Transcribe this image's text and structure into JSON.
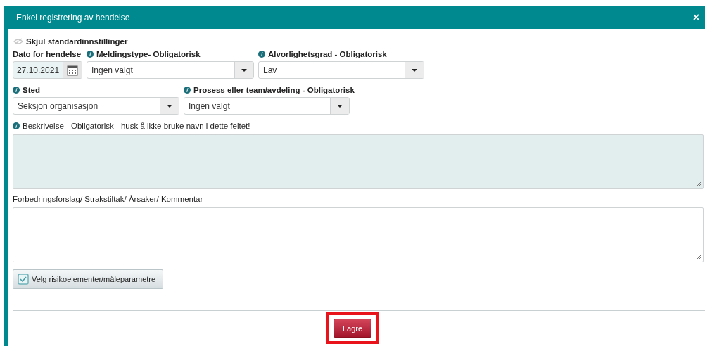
{
  "window": {
    "title": "Enkel registrering av hendelse",
    "close": "×"
  },
  "toggle": {
    "label": "Skjul standardinnstillinger"
  },
  "rows": [
    [
      {
        "kind": "date",
        "label": "Dato for hendelse",
        "info": false,
        "value": "27.10.2021"
      },
      {
        "kind": "select",
        "label": "Meldingstype- Obligatorisk",
        "info": true,
        "value": "Ingen valgt"
      },
      {
        "kind": "select",
        "label": "Alvorlighetsgrad - Obligatorisk",
        "info": true,
        "value": "Lav"
      }
    ],
    [
      {
        "kind": "select",
        "label": "Sted",
        "info": true,
        "value": "Seksjon organisasjon"
      },
      {
        "kind": "select",
        "label": "Prosess eller team/avdeling - Obligatorisk",
        "info": true,
        "value": "Ingen valgt"
      }
    ]
  ],
  "textareas": [
    {
      "label": "Beskrivelse - Obligatorisk - husk å ikke bruke navn i dette feltet!",
      "info": true,
      "tinted": true
    },
    {
      "label": "Forbedringsforslag/ Strakstiltak/ Årsaker/ Kommentar",
      "info": false,
      "tinted": false
    }
  ],
  "option_button": {
    "label": "Velg risikoelementer/måleparametre",
    "checked": true
  },
  "save_button": {
    "label": "Lagre",
    "highlighted": true
  }
}
